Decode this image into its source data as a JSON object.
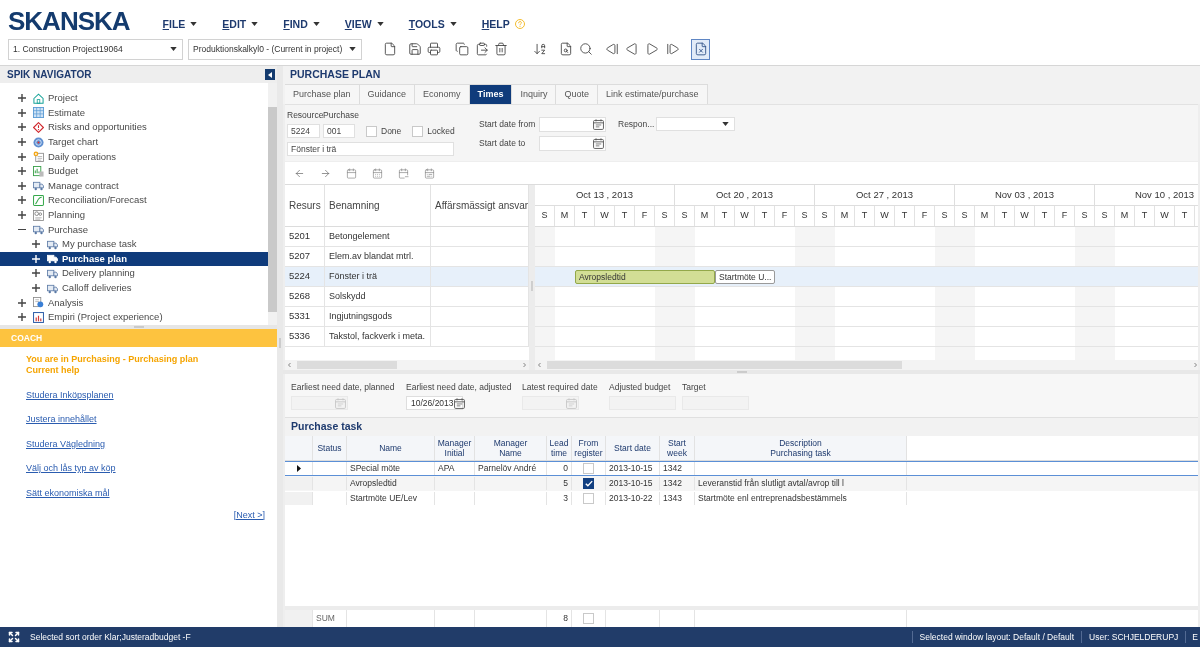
{
  "header": {
    "logo": "SKANSKA",
    "menus": [
      {
        "label": "FILE",
        "kind": "dropdown"
      },
      {
        "label": "EDIT",
        "kind": "dropdown"
      },
      {
        "label": "FIND",
        "kind": "dropdown"
      },
      {
        "label": "VIEW",
        "kind": "dropdown"
      },
      {
        "label": "TOOLS",
        "kind": "dropdown"
      },
      {
        "label": "HELP",
        "kind": "help"
      }
    ],
    "project_select": "1. Construction Project19064",
    "calculation_select": "Produktionskalkyl0 - (Current in project)",
    "layout_toggle": {
      "pressed": true
    }
  },
  "navigator": {
    "title": "SPIK NAVIGATOR",
    "items": [
      {
        "label": "Project",
        "kind": "project",
        "expanded": false,
        "selected": false
      },
      {
        "label": "Estimate",
        "kind": "estimate",
        "expanded": false,
        "selected": false
      },
      {
        "label": "Risks and opportunities",
        "kind": "risk",
        "expanded": false,
        "selected": false
      },
      {
        "label": "Target chart",
        "kind": "target",
        "expanded": false,
        "selected": false
      },
      {
        "label": "Daily operations",
        "kind": "operations",
        "expanded": false,
        "selected": false
      },
      {
        "label": "Budget",
        "kind": "budget",
        "expanded": false,
        "selected": false
      },
      {
        "label": "Manage contract",
        "kind": "contract",
        "expanded": false,
        "selected": false
      },
      {
        "label": "Reconciliation/Forecast",
        "kind": "forecast",
        "expanded": false,
        "selected": false
      },
      {
        "label": "Planning",
        "kind": "planning",
        "expanded": false,
        "selected": false
      },
      {
        "label": "Purchase",
        "kind": "purchase",
        "expanded": true,
        "selected": false,
        "children": [
          {
            "label": "My purchase task",
            "kind": "purchase",
            "expanded": false,
            "selected": false
          },
          {
            "label": "Purchase plan",
            "kind": "purchase",
            "expanded": false,
            "selected": true
          },
          {
            "label": "Delivery planning",
            "kind": "purchase",
            "expanded": false,
            "selected": false
          },
          {
            "label": "Calloff deliveries",
            "kind": "purchase",
            "expanded": false,
            "selected": false
          }
        ]
      },
      {
        "label": "Analysis",
        "kind": "analysis",
        "expanded": false,
        "selected": false
      },
      {
        "label": "Empiri (Project experience)",
        "kind": "experience",
        "expanded": false,
        "selected": false
      }
    ]
  },
  "coach": {
    "title": "COACH",
    "context": [
      "You are in Purchasing - Purchasing plan",
      "Current help"
    ],
    "links": [
      "Studera Inköpsplanen",
      "Justera innehållet",
      "Studera Vägledning",
      "Välj och lås typ av köp",
      "Sätt ekonomiska mål"
    ],
    "next": "[Next >]"
  },
  "purchase_plan": {
    "title": "PURCHASE PLAN",
    "tabs": [
      {
        "label": "Purchase plan",
        "selected": false
      },
      {
        "label": "Guidance",
        "selected": false
      },
      {
        "label": "Economy",
        "selected": false
      },
      {
        "label": "Times",
        "selected": true
      },
      {
        "label": "Inquiry",
        "selected": false
      },
      {
        "label": "Quote",
        "selected": false
      },
      {
        "label": "Link estimate/purchase",
        "selected": false
      }
    ],
    "filters": {
      "resource": {
        "label": "Resource",
        "value": "5224"
      },
      "purchase": {
        "label": "Purchase",
        "value": "001"
      },
      "checkboxes": [
        {
          "label": "Done",
          "checked": false
        },
        {
          "label": "Locked",
          "checked": false
        }
      ],
      "name": "Fönster i trä",
      "start_from": {
        "label": "Start date from"
      },
      "start_to": {
        "label": "Start date to"
      },
      "responsible": {
        "label": "Respon..."
      }
    },
    "grid": {
      "columns": [
        "Resurs",
        "Benamning",
        "Affärsmässigt ansvar"
      ],
      "rows": [
        {
          "resurs": "5201",
          "benamning": "Betongelement",
          "selected": false
        },
        {
          "resurs": "5207",
          "benamning": "Elem.av blandat mtrl.",
          "selected": false
        },
        {
          "resurs": "5224",
          "benamning": "Fönster i trä",
          "selected": true,
          "bars": [
            {
              "label": "Avropsledtid",
              "kind": "lead"
            },
            {
              "label": "Startmöte U...",
              "kind": "meeting"
            }
          ]
        },
        {
          "resurs": "5268",
          "benamning": "Solskydd",
          "selected": false
        },
        {
          "resurs": "5331",
          "benamning": "Ingjutningsgods",
          "selected": false
        },
        {
          "resurs": "5336",
          "benamning": "Takstol, fackverk i meta.",
          "selected": false
        }
      ]
    },
    "gantt": {
      "weeks": [
        {
          "label": "Oct 13 , 2013",
          "days": [
            "S",
            "M",
            "T",
            "W",
            "T",
            "F",
            "S"
          ]
        },
        {
          "label": "Oct 20 , 2013",
          "days": [
            "S",
            "M",
            "T",
            "W",
            "T",
            "F",
            "S"
          ]
        },
        {
          "label": "Oct 27 , 2013",
          "days": [
            "S",
            "M",
            "T",
            "W",
            "T",
            "F",
            "S"
          ]
        },
        {
          "label": "Nov 03 , 2013",
          "days": [
            "S",
            "M",
            "T",
            "W",
            "T",
            "F",
            "S"
          ]
        },
        {
          "label": "Nov 10 , 2013",
          "days": [
            "S",
            "M",
            "T",
            "W",
            "T"
          ]
        }
      ]
    },
    "dates": [
      {
        "label": "Earliest need date, planned",
        "kind": "date",
        "disabled": true
      },
      {
        "label": "Earliest need date, adjusted",
        "kind": "date",
        "disabled": false,
        "value": "10/26/2013"
      },
      {
        "label": "Latest required date",
        "kind": "date",
        "disabled": true
      },
      {
        "label": "Adjusted budget",
        "kind": "text",
        "disabled": true
      },
      {
        "label": "Target",
        "kind": "text",
        "disabled": true
      }
    ],
    "purchase_task": {
      "title": "Purchase task",
      "columns": [
        {
          "lines": [
            "Status"
          ]
        },
        {
          "lines": [
            "Name"
          ]
        },
        {
          "lines": [
            "Manager",
            "Initial"
          ]
        },
        {
          "lines": [
            "Manager",
            "Name"
          ]
        },
        {
          "lines": [
            "Lead",
            "time"
          ]
        },
        {
          "lines": [
            "From",
            "register"
          ]
        },
        {
          "lines": [
            "Start date"
          ]
        },
        {
          "lines": [
            "Start",
            "week"
          ]
        },
        {
          "lines": [
            "Description",
            "Purchasing task"
          ]
        }
      ],
      "rows": [
        {
          "current": true,
          "name": "SPecial möte",
          "manager_initial": "APA",
          "manager_name": "Parnelöv André",
          "lead_time": "0",
          "from_register": false,
          "start_date": "2013-10-15",
          "start_week": "1342"
        },
        {
          "current": false,
          "name": "Avropsledtid",
          "lead_time": "5",
          "from_register": true,
          "start_date": "2013-10-15",
          "start_week": "1342",
          "description": "Leveranstid från slutligt avtal/avrop till l"
        },
        {
          "current": false,
          "name": "Startmöte UE/Lev",
          "lead_time": "3",
          "from_register": false,
          "start_date": "2013-10-22",
          "start_week": "1343",
          "description": "Startmöte enl entreprenadsbestämmels"
        }
      ],
      "sum": {
        "label": "SUM",
        "lead_time": "8",
        "from_register": false
      }
    }
  },
  "status_bar": {
    "sort": "Selected sort order Klar;Justeradbudget -F",
    "layout": "Selected window layout: Default / Default",
    "user": "User: SCHJELDERUPJ",
    "overflow": "E"
  }
}
